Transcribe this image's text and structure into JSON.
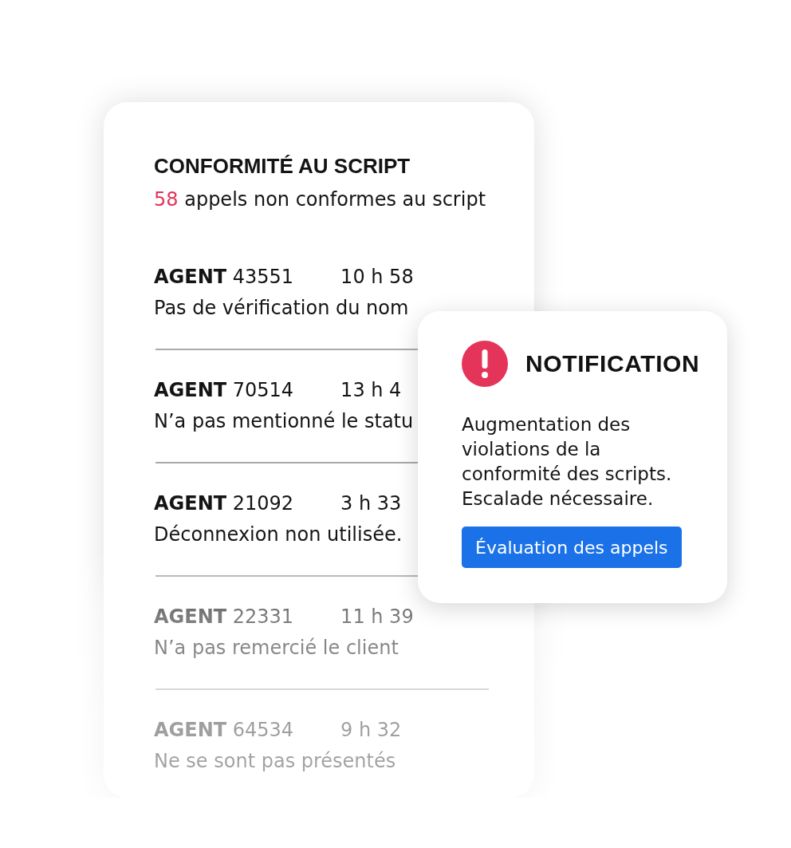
{
  "compliance_card": {
    "title": "CONFORMITÉ AU SCRIPT",
    "count": "58",
    "summary": "appels non conformes au script",
    "calls": [
      {
        "agent": "**AGENT** 43551",
        "time": "10 h 58",
        "issue": "Pas de vérification du nom"
      },
      {
        "agent": "**AGENT** 70514",
        "time": "13 h 4",
        "issue": "N’a pas mentionné le statu"
      },
      {
        "agent": "**AGENT** 21092",
        "time": "3 h 33",
        "issue": "Déconnexion non utilisée."
      },
      {
        "agent": "**AGENT** 22331",
        "time": "11 h 39",
        "issue": "N’a pas remercié le client"
      },
      {
        "agent": "**AGENT** 64534",
        "time": "9 h 32",
        "issue": "Ne se sont pas présentés"
      }
    ]
  },
  "notification": {
    "title": "NOTIFICATION",
    "message": "Augmentation des violations de la conformité des scripts. Escalade nécessaire.",
    "button": "Évaluation des appels"
  }
}
